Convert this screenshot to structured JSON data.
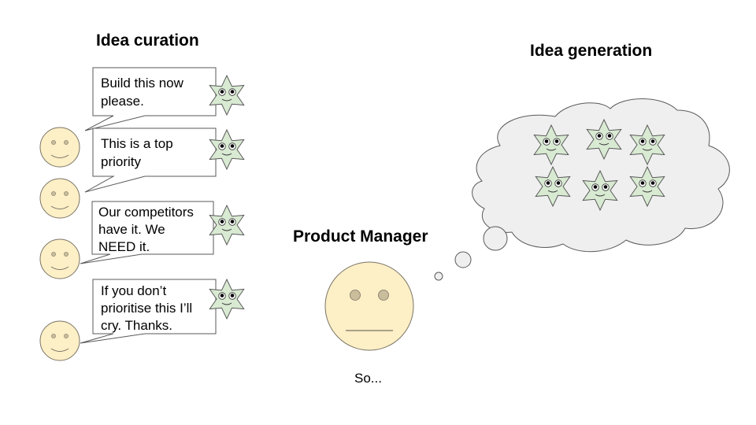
{
  "titles": {
    "curation": "Idea curation",
    "generation": "Idea generation",
    "product_manager": "Product Manager"
  },
  "pm_caption": "So...",
  "speech_bubbles": [
    {
      "lines": [
        "Build this now",
        "please."
      ]
    },
    {
      "lines": [
        "This is a top",
        "priority"
      ]
    },
    {
      "lines": [
        "Our competitors",
        "have it. We",
        "NEED it."
      ]
    },
    {
      "lines": [
        "If you don’t",
        "prioritise this I’ll",
        "cry. Thanks."
      ]
    }
  ],
  "colors": {
    "face_fill": "#fdefc6",
    "face_stroke": "#7a7466",
    "star_fill": "#d9ead3",
    "star_stroke": "#595959",
    "cloud_fill": "#efefef",
    "cloud_stroke": "#595959",
    "pm_eye_fill": "#c9bd9b"
  }
}
